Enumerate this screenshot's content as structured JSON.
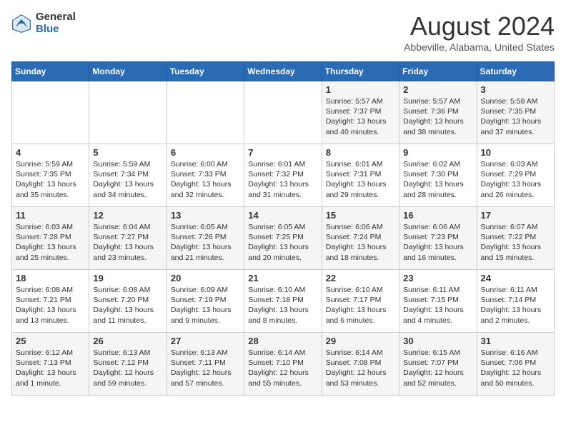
{
  "header": {
    "logo_general": "General",
    "logo_blue": "Blue",
    "month_title": "August 2024",
    "location": "Abbeville, Alabama, United States"
  },
  "calendar": {
    "days_of_week": [
      "Sunday",
      "Monday",
      "Tuesday",
      "Wednesday",
      "Thursday",
      "Friday",
      "Saturday"
    ],
    "weeks": [
      [
        {
          "day": "",
          "info": ""
        },
        {
          "day": "",
          "info": ""
        },
        {
          "day": "",
          "info": ""
        },
        {
          "day": "",
          "info": ""
        },
        {
          "day": "1",
          "info": "Sunrise: 5:57 AM\nSunset: 7:37 PM\nDaylight: 13 hours\nand 40 minutes."
        },
        {
          "day": "2",
          "info": "Sunrise: 5:57 AM\nSunset: 7:36 PM\nDaylight: 13 hours\nand 38 minutes."
        },
        {
          "day": "3",
          "info": "Sunrise: 5:58 AM\nSunset: 7:35 PM\nDaylight: 13 hours\nand 37 minutes."
        }
      ],
      [
        {
          "day": "4",
          "info": "Sunrise: 5:59 AM\nSunset: 7:35 PM\nDaylight: 13 hours\nand 35 minutes."
        },
        {
          "day": "5",
          "info": "Sunrise: 5:59 AM\nSunset: 7:34 PM\nDaylight: 13 hours\nand 34 minutes."
        },
        {
          "day": "6",
          "info": "Sunrise: 6:00 AM\nSunset: 7:33 PM\nDaylight: 13 hours\nand 32 minutes."
        },
        {
          "day": "7",
          "info": "Sunrise: 6:01 AM\nSunset: 7:32 PM\nDaylight: 13 hours\nand 31 minutes."
        },
        {
          "day": "8",
          "info": "Sunrise: 6:01 AM\nSunset: 7:31 PM\nDaylight: 13 hours\nand 29 minutes."
        },
        {
          "day": "9",
          "info": "Sunrise: 6:02 AM\nSunset: 7:30 PM\nDaylight: 13 hours\nand 28 minutes."
        },
        {
          "day": "10",
          "info": "Sunrise: 6:03 AM\nSunset: 7:29 PM\nDaylight: 13 hours\nand 26 minutes."
        }
      ],
      [
        {
          "day": "11",
          "info": "Sunrise: 6:03 AM\nSunset: 7:28 PM\nDaylight: 13 hours\nand 25 minutes."
        },
        {
          "day": "12",
          "info": "Sunrise: 6:04 AM\nSunset: 7:27 PM\nDaylight: 13 hours\nand 23 minutes."
        },
        {
          "day": "13",
          "info": "Sunrise: 6:05 AM\nSunset: 7:26 PM\nDaylight: 13 hours\nand 21 minutes."
        },
        {
          "day": "14",
          "info": "Sunrise: 6:05 AM\nSunset: 7:25 PM\nDaylight: 13 hours\nand 20 minutes."
        },
        {
          "day": "15",
          "info": "Sunrise: 6:06 AM\nSunset: 7:24 PM\nDaylight: 13 hours\nand 18 minutes."
        },
        {
          "day": "16",
          "info": "Sunrise: 6:06 AM\nSunset: 7:23 PM\nDaylight: 13 hours\nand 16 minutes."
        },
        {
          "day": "17",
          "info": "Sunrise: 6:07 AM\nSunset: 7:22 PM\nDaylight: 13 hours\nand 15 minutes."
        }
      ],
      [
        {
          "day": "18",
          "info": "Sunrise: 6:08 AM\nSunset: 7:21 PM\nDaylight: 13 hours\nand 13 minutes."
        },
        {
          "day": "19",
          "info": "Sunrise: 6:08 AM\nSunset: 7:20 PM\nDaylight: 13 hours\nand 11 minutes."
        },
        {
          "day": "20",
          "info": "Sunrise: 6:09 AM\nSunset: 7:19 PM\nDaylight: 13 hours\nand 9 minutes."
        },
        {
          "day": "21",
          "info": "Sunrise: 6:10 AM\nSunset: 7:18 PM\nDaylight: 13 hours\nand 8 minutes."
        },
        {
          "day": "22",
          "info": "Sunrise: 6:10 AM\nSunset: 7:17 PM\nDaylight: 13 hours\nand 6 minutes."
        },
        {
          "day": "23",
          "info": "Sunrise: 6:11 AM\nSunset: 7:15 PM\nDaylight: 13 hours\nand 4 minutes."
        },
        {
          "day": "24",
          "info": "Sunrise: 6:11 AM\nSunset: 7:14 PM\nDaylight: 13 hours\nand 2 minutes."
        }
      ],
      [
        {
          "day": "25",
          "info": "Sunrise: 6:12 AM\nSunset: 7:13 PM\nDaylight: 13 hours\nand 1 minute."
        },
        {
          "day": "26",
          "info": "Sunrise: 6:13 AM\nSunset: 7:12 PM\nDaylight: 12 hours\nand 59 minutes."
        },
        {
          "day": "27",
          "info": "Sunrise: 6:13 AM\nSunset: 7:11 PM\nDaylight: 12 hours\nand 57 minutes."
        },
        {
          "day": "28",
          "info": "Sunrise: 6:14 AM\nSunset: 7:10 PM\nDaylight: 12 hours\nand 55 minutes."
        },
        {
          "day": "29",
          "info": "Sunrise: 6:14 AM\nSunset: 7:08 PM\nDaylight: 12 hours\nand 53 minutes."
        },
        {
          "day": "30",
          "info": "Sunrise: 6:15 AM\nSunset: 7:07 PM\nDaylight: 12 hours\nand 52 minutes."
        },
        {
          "day": "31",
          "info": "Sunrise: 6:16 AM\nSunset: 7:06 PM\nDaylight: 12 hours\nand 50 minutes."
        }
      ]
    ]
  }
}
